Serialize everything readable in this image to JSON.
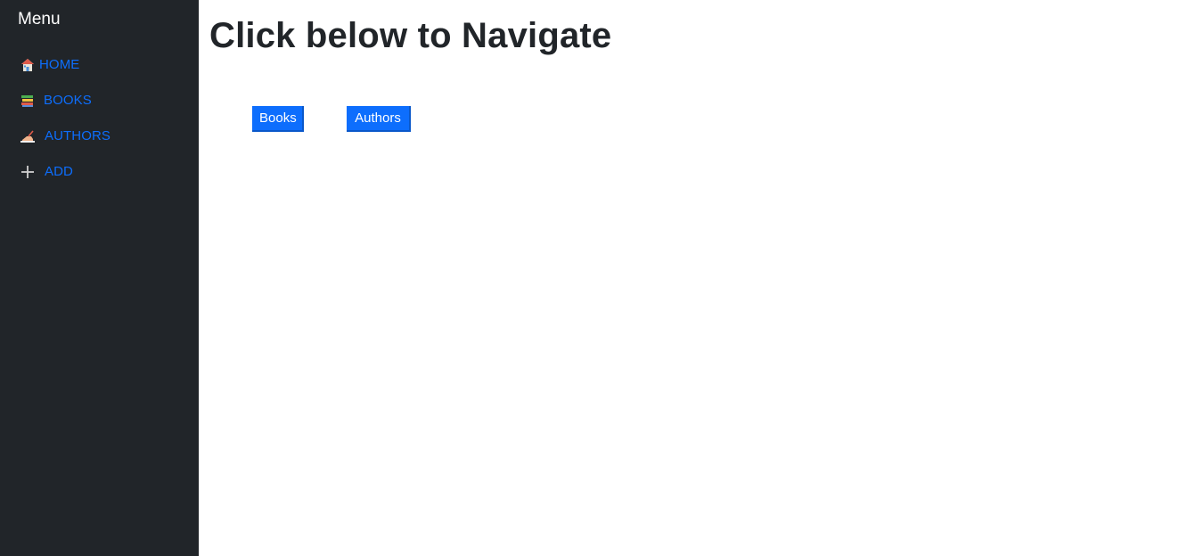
{
  "sidebar": {
    "title": "Menu",
    "items": [
      {
        "label": "HOME",
        "icon": "house-icon"
      },
      {
        "label": "BOOKS",
        "icon": "books-icon"
      },
      {
        "label": "AUTHORS",
        "icon": "writing-hand-icon"
      },
      {
        "label": "ADD",
        "icon": "plus-icon"
      }
    ]
  },
  "main": {
    "title": "Click below to Navigate",
    "buttons": [
      {
        "label": "Books"
      },
      {
        "label": "Authors"
      }
    ]
  },
  "colors": {
    "sidebar_bg": "#212529",
    "link": "#0d6efd",
    "button_bg": "#0d6efd",
    "heading": "#212529"
  }
}
